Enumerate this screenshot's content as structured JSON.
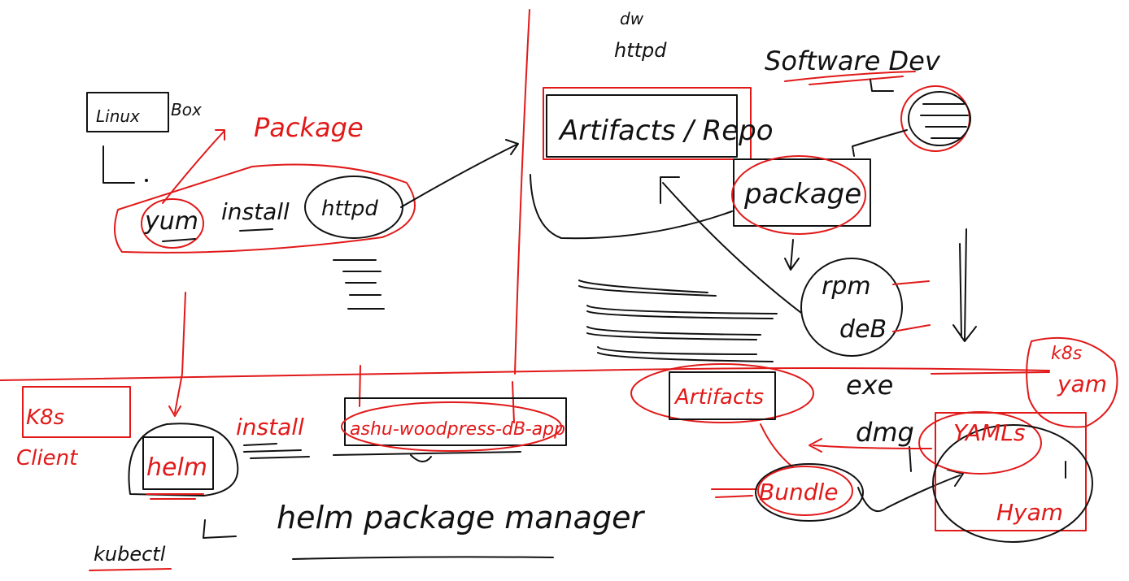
{
  "labels": {
    "linux": "Linux",
    "box": "Box",
    "package_top": "Package",
    "yum": "yum",
    "install_top": "install",
    "httpd_top": "httpd",
    "dw": "dw",
    "httpd_right": "httpd",
    "artifacts_repo": "Artifacts / Repo",
    "software_dev": "Software Dev",
    "package_right": "package",
    "rpm": "rpm",
    "deb": "deB",
    "exe": "exe",
    "dmg": "dmg",
    "artifacts_bottom": "Artifacts",
    "bundle": "Bundle",
    "yamls": "YAMLs",
    "yam_box": "Hyam",
    "k8s_yam_1": "k8s",
    "k8s_yam_2": "yam",
    "k8s_client_1": "K8s",
    "k8s_client_2": "Client",
    "helm": "helm",
    "install_bottom": "install",
    "chart_name": "ashu-woodpress-dB-app",
    "helm_package_manager": "helm package manager",
    "kubectl": "kubectl"
  },
  "colors": {
    "ink": "#111111",
    "red_ink": "#e11919",
    "background": "#ffffff"
  }
}
